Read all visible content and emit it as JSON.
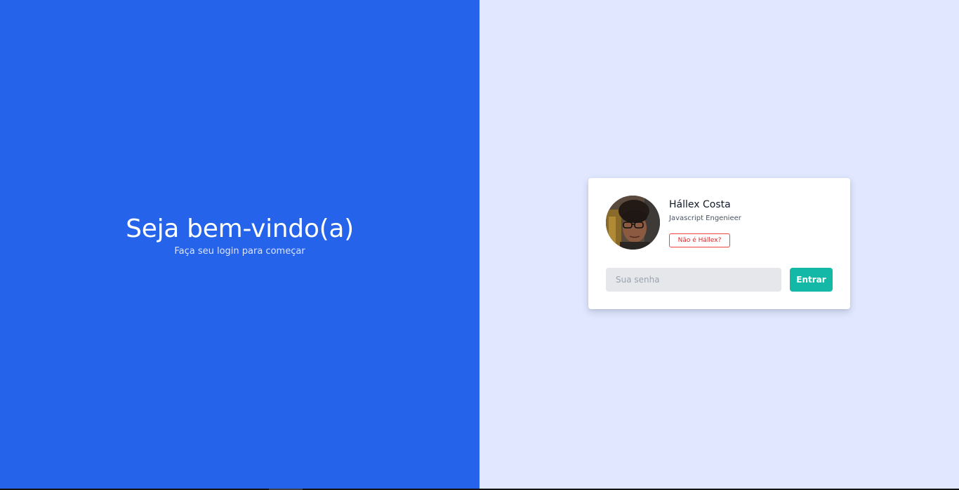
{
  "welcome": {
    "title": "Seja bem-vindo(a)",
    "subtitle": "Faça seu login para começar"
  },
  "profile": {
    "name": "Hállex Costa",
    "role": "Javascript Engenieer",
    "switch_user_label": "Não é Hállex?",
    "avatar_icon": "user-photo"
  },
  "login": {
    "password_placeholder": "Sua senha",
    "password_value": "",
    "submit_label": "Entrar"
  },
  "colors": {
    "left_panel": "#2563eb",
    "right_panel": "#e0e7ff",
    "accent_button": "#14b8a6",
    "danger": "#ef4444"
  }
}
